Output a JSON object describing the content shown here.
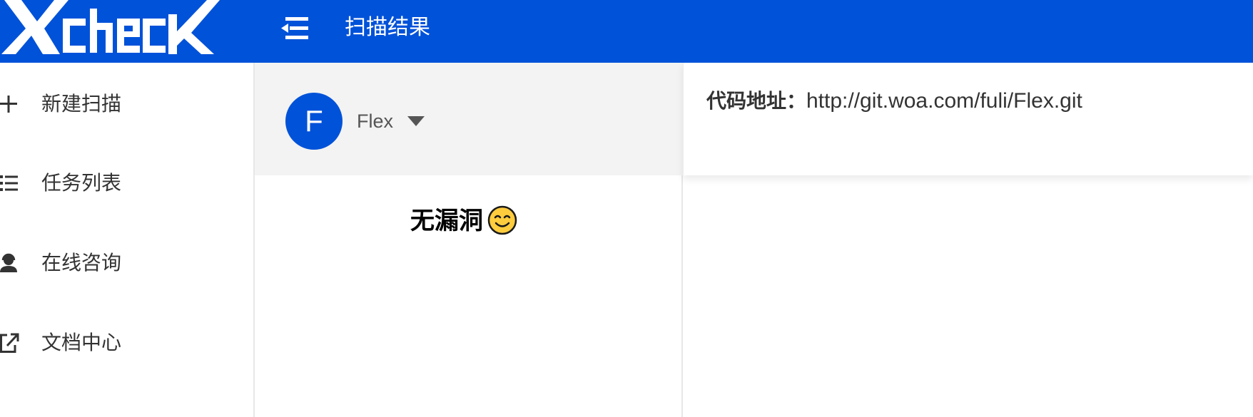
{
  "app": {
    "logo_text": "XcheK",
    "brand_color": "#0052D9"
  },
  "header": {
    "menu_icon": "menu-fold-icon",
    "title": "扫描结果"
  },
  "sidebar": {
    "items": [
      {
        "label": "新建扫描",
        "icon": "plus-icon"
      },
      {
        "label": "任务列表",
        "icon": "list-icon"
      },
      {
        "label": "在线咨询",
        "icon": "support-agent-icon"
      },
      {
        "label": "文档中心",
        "icon": "external-link-icon"
      }
    ]
  },
  "project": {
    "avatar_letter": "F",
    "name": "Flex"
  },
  "result": {
    "status_text": "无漏洞",
    "status_icon": "smile-emoji-icon"
  },
  "repo": {
    "label": "代码地址：",
    "url": "http://git.woa.com/fuli/Flex.git"
  }
}
